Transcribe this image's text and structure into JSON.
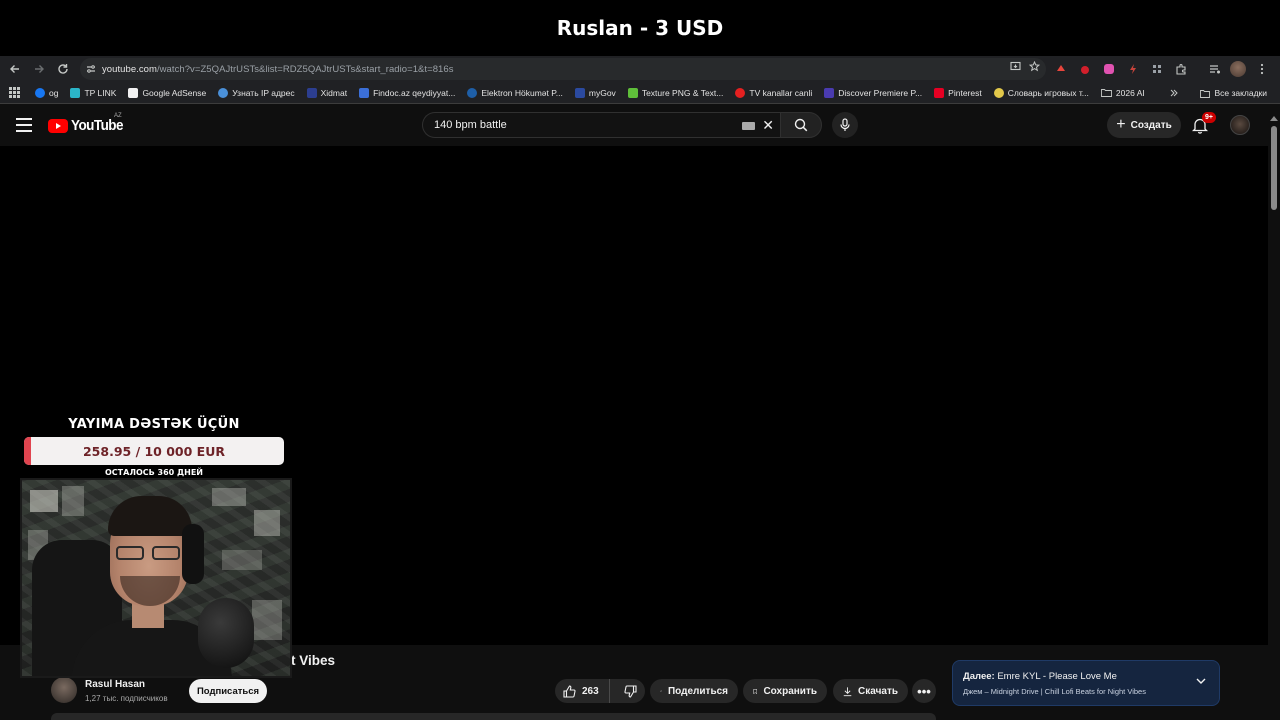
{
  "stream_title": "Ruslan - 3 USD",
  "browser": {
    "url_host": "youtube.com",
    "url_path": "/watch?v=Z5QAJtrUSTs&list=RDZ5QAJtrUSTs&start_radio=1&t=816s",
    "bookmarks": [
      {
        "label": "og",
        "icon_color": "#1877f2"
      },
      {
        "label": "TP LINK",
        "icon_color": "#2bb5c8"
      },
      {
        "label": "Google AdSense",
        "icon_color": "#f1f1f1"
      },
      {
        "label": "Узнать IP адрес",
        "icon_color": "#4a90d9"
      },
      {
        "label": "Xidmat",
        "icon_color": "#2c3e90"
      },
      {
        "label": "Findoc.az qeydiyyat...",
        "icon_color": "#3b6fd8"
      },
      {
        "label": "Elektron Hökumət P...",
        "icon_color": "#1e5fa8"
      },
      {
        "label": "myGov",
        "icon_color": "#2b4aa0"
      },
      {
        "label": "Texture PNG & Text...",
        "icon_color": "#5fbf3a"
      },
      {
        "label": "TV kanallar canli",
        "icon_color": "#e52020"
      },
      {
        "label": "Discover Premiere P...",
        "icon_color": "#4a3bb0"
      },
      {
        "label": "Pinterest",
        "icon_color": "#e60023"
      },
      {
        "label": "Словарь игровых т...",
        "icon_color": "#e2c84a"
      },
      {
        "label": "2026 AI",
        "icon_color": "folder"
      }
    ],
    "all_bookmarks_label": "Все закладки"
  },
  "youtube": {
    "logo_text": "YouTube",
    "country_code": "AZ",
    "search_value": "140 bpm battle",
    "create_label": "Создать",
    "notification_count": "9+"
  },
  "video": {
    "title_partial": "t Vibes",
    "channel_name": "Rasul Hasan",
    "subscribers": "1,27 тыс. подписчиков",
    "subscribe_label": "Подписаться",
    "likes": "263",
    "share_label": "Поделиться",
    "save_label": "Сохранить",
    "download_label": "Скачать",
    "more_label": "•••"
  },
  "up_next": {
    "prefix": "Далее:",
    "title": "Emre KYL - Please Love Me",
    "subtitle": "Джем – Midnight Drive | Chill Lofi Beats for Night Vibes"
  },
  "donation": {
    "title": "YAYIMA DƏSTƏK ÜÇÜN",
    "amount_text": "258.95 / 10 000 EUR",
    "raised": 258.95,
    "goal": 10000,
    "days_left_text": "ОСТАЛОСЬ 360 ДНЕЙ",
    "fill_color": "#e0444f"
  }
}
